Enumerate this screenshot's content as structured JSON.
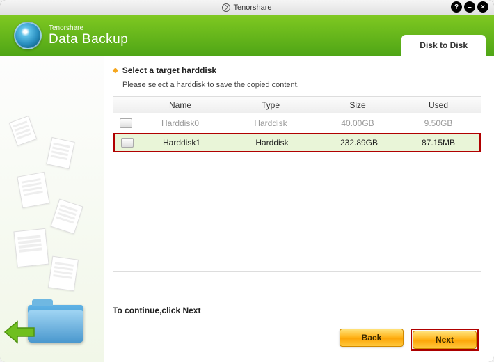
{
  "titlebar": {
    "title": "Tenorshare"
  },
  "header": {
    "brand": "Tenorshare",
    "app": "Data Backup",
    "tab_label": "Disk to Disk"
  },
  "section": {
    "title": "Select a target harddisk",
    "subtitle": "Please select a harddisk to save the copied content."
  },
  "columns": {
    "name": "Name",
    "type": "Type",
    "size": "Size",
    "used": "Used"
  },
  "disks": [
    {
      "name": "Harddisk0",
      "type": "Harddisk",
      "size": "40.00GB",
      "used": "9.50GB",
      "selected": false
    },
    {
      "name": "Harddisk1",
      "type": "Harddisk",
      "size": "232.89GB",
      "used": "87.15MB",
      "selected": true
    }
  ],
  "footer": {
    "hint": "To continue,click Next",
    "back": "Back",
    "next": "Next"
  }
}
